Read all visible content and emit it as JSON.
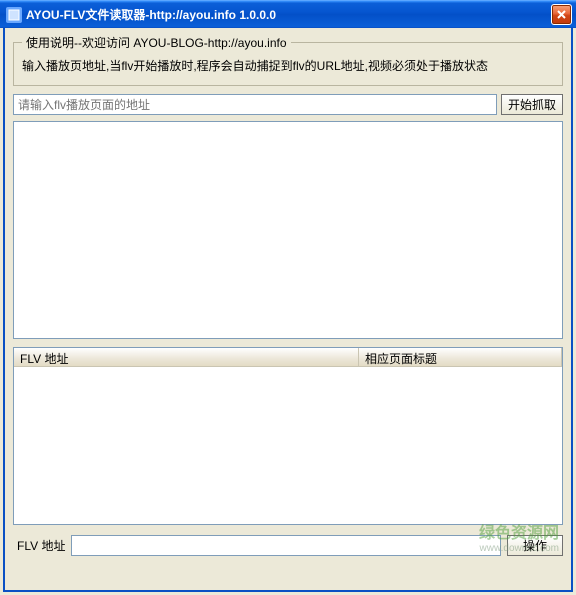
{
  "titlebar": {
    "title": "AYOU-FLV文件读取器-http://ayou.info 1.0.0.0"
  },
  "help": {
    "legend": "使用说明--欢迎访问 AYOU-BLOG-http://ayou.info",
    "text": "输入播放页地址,当flv开始播放时,程序会自动捕捉到flv的URL地址,视频必须处于播放状态"
  },
  "inputRow": {
    "placeholder": "请输入flv播放页面的地址",
    "startButton": "开始抓取"
  },
  "listview": {
    "col1": "FLV 地址",
    "col2": "相应页面标题"
  },
  "bottom": {
    "label": "FLV 地址",
    "action": "操作"
  },
  "watermark": {
    "main": "绿色资源网",
    "sub": "www.downcc.com"
  }
}
